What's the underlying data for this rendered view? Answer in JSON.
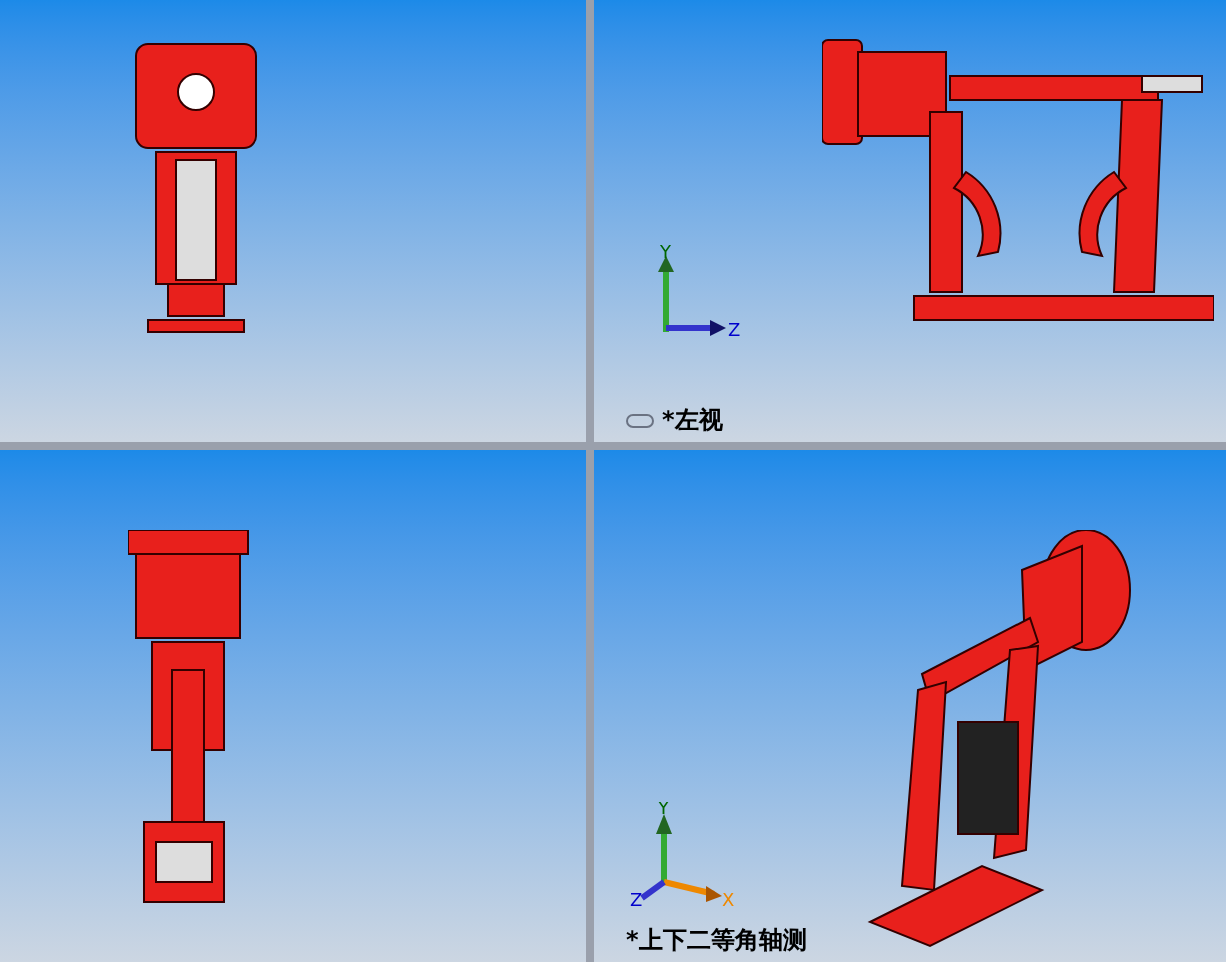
{
  "viewports": [
    {
      "kind": "front"
    },
    {
      "kind": "side",
      "triad": {
        "kind": "side",
        "labels": [
          "Y",
          "Z"
        ]
      },
      "label": "*左视"
    },
    {
      "kind": "top"
    },
    {
      "kind": "iso",
      "triad": {
        "kind": "iso",
        "labels": [
          "Y",
          "Z",
          "X"
        ]
      },
      "label": "*上下二等角轴测"
    }
  ]
}
